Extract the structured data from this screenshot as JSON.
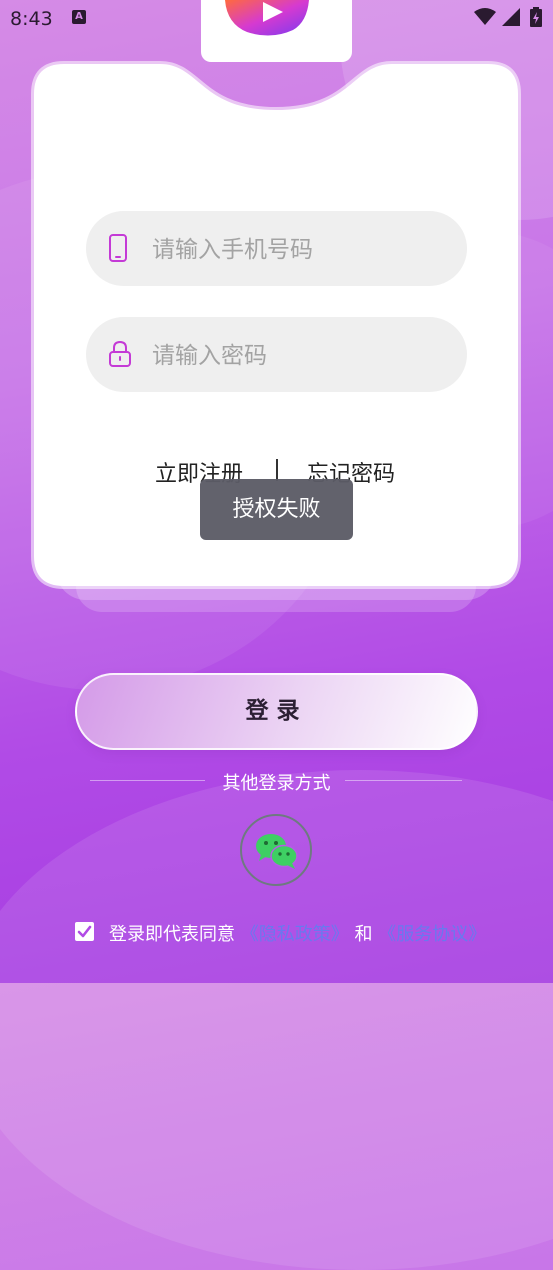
{
  "status_bar": {
    "time": "8:43",
    "notification_icon": "a-notification-icon",
    "wifi_icon": "wifi-icon",
    "signal_icon": "signal-icon",
    "battery_icon": "battery-icon"
  },
  "logo": {
    "icon": "app-logo-icon"
  },
  "form": {
    "phone_placeholder": "请输入手机号码",
    "phone_value": "",
    "phone_icon": "mobile-phone-icon",
    "password_placeholder": "请输入密码",
    "password_value": "",
    "password_icon": "lock-icon"
  },
  "links": {
    "register": "立即注册",
    "forgot": "忘记密码"
  },
  "toast": {
    "text": "授权失败"
  },
  "login_button": {
    "label": "登录"
  },
  "other_login": {
    "label": "其他登录方式",
    "wechat_icon": "wechat-icon"
  },
  "agreement": {
    "checked": true,
    "prefix": "登录即代表同意",
    "privacy": "《隐私政策》",
    "conjunction": "和",
    "service": "《服务协议》"
  },
  "colors": {
    "accent_purple": "#b14be6",
    "icon_magenta": "#c43ad6",
    "link_blue": "#6a78ef",
    "wechat_green": "#3ecf63"
  }
}
